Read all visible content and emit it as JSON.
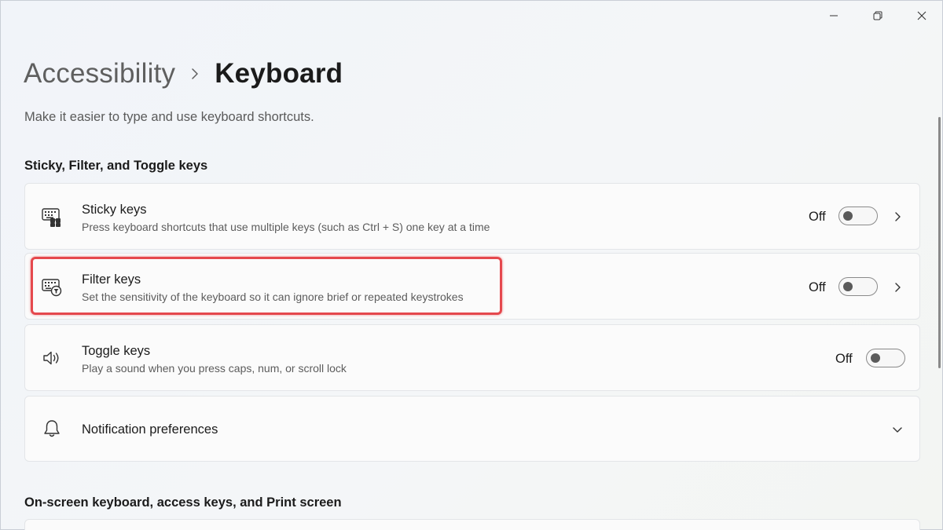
{
  "header": {
    "breadcrumb_parent": "Accessibility",
    "breadcrumb_current": "Keyboard",
    "subtitle": "Make it easier to type and use keyboard shortcuts."
  },
  "window_controls": {
    "minimize_icon": "minimize-icon",
    "maximize_icon": "restore-icon",
    "close_icon": "close-icon"
  },
  "sections": {
    "sticky_filter_toggle": "Sticky, Filter, and Toggle keys",
    "osk": "On-screen keyboard, access keys, and Print screen"
  },
  "settings": {
    "sticky": {
      "title": "Sticky keys",
      "desc": "Press keyboard shortcuts that use multiple keys (such as Ctrl + S) one key at a time",
      "state": "Off",
      "icon": "sticky-keys-icon"
    },
    "filter": {
      "title": "Filter keys",
      "desc": "Set the sensitivity of the keyboard so it can ignore brief or repeated keystrokes",
      "state": "Off",
      "icon": "filter-keys-icon"
    },
    "toggle": {
      "title": "Toggle keys",
      "desc": "Play a sound when you press caps, num, or scroll lock",
      "state": "Off",
      "icon": "speaker-icon"
    },
    "notify": {
      "title": "Notification preferences",
      "icon": "bell-icon"
    }
  },
  "colors": {
    "highlight": "#e5484d",
    "card_bg": "#fbfbfb",
    "toggle_off": "#5a5a5a"
  }
}
